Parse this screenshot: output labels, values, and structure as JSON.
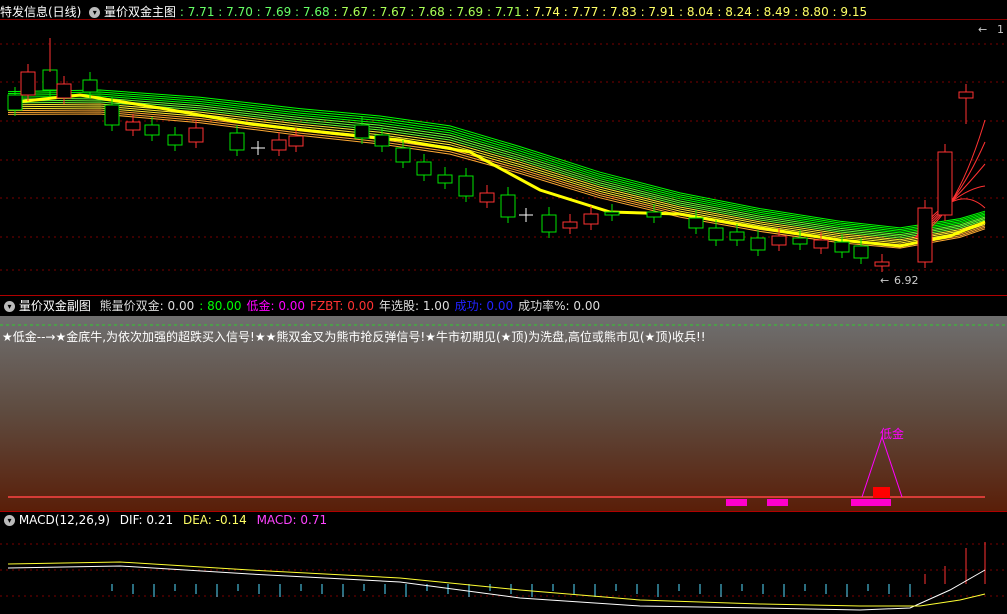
{
  "main_header": {
    "stock_name": "特发信息(日线)",
    "indicator": "量价双金主图",
    "values": [
      "7.71",
      "7.70",
      "7.69",
      "7.68",
      "7.67",
      "7.67",
      "7.68",
      "7.69",
      "7.71",
      "7.74",
      "7.77",
      "7.83",
      "7.91",
      "8.04",
      "8.24",
      "8.49",
      "8.80",
      "9.15"
    ]
  },
  "main_chart": {
    "low_label": "6.92",
    "corner_label": "1",
    "colors": {
      "up": "#ff3232",
      "down": "#00e600",
      "ma_green": "#00ff00",
      "ma_yellow": "#ffff00",
      "ma_red": "#ff3232"
    }
  },
  "sub_header": {
    "indicator": "量价双金副图",
    "items": [
      {
        "label": "熊量价双金:",
        "value": "0.00",
        "color": "#dddddd"
      },
      {
        "label": ":",
        "value": "80.00",
        "color": "#00ff00"
      },
      {
        "label": "低金:",
        "value": "0.00",
        "color": "#ff00ff"
      },
      {
        "label": "FZBT:",
        "value": "0.00",
        "color": "#ff3232"
      },
      {
        "label": "年选股:",
        "value": "1.00",
        "color": "#dddddd"
      },
      {
        "label": "成功:",
        "value": "0.00",
        "color": "#2222ff"
      },
      {
        "label": "成功率%:",
        "value": "0.00",
        "color": "#dddddd"
      }
    ],
    "legend_text": "★低金--→★金底牛,为依次加强的超跌买入信号!★★熊双金叉为熊市抢反弹信号!★牛市初期见(★顶)为洗盘,高位或熊市见(★顶)收兵!!",
    "signal_label": "低金"
  },
  "macd_header": {
    "indicator": "MACD(12,26,9)",
    "dif_label": "DIF:",
    "dif_value": "0.21",
    "dea_label": "DEA:",
    "dea_value": "-0.14",
    "macd_label": "MACD:",
    "macd_value": "0.71"
  }
}
